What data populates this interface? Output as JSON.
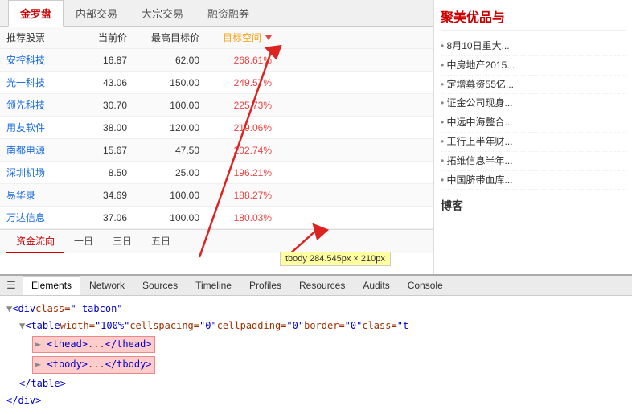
{
  "tabs": {
    "items": [
      {
        "label": "金罗盘",
        "active": true
      },
      {
        "label": "内部交易",
        "active": false
      },
      {
        "label": "大宗交易",
        "active": false
      },
      {
        "label": "融资融券",
        "active": false
      }
    ]
  },
  "table": {
    "headers": {
      "stock": "推荐股票",
      "current_price": "当前价",
      "max_target": "最高目标价",
      "target_space": "目标空间"
    },
    "rows": [
      {
        "name": "安控科技",
        "cur_price": "16.87",
        "max_price": "62.00",
        "space": "268.61%"
      },
      {
        "name": "光一科技",
        "cur_price": "43.06",
        "max_price": "150.00",
        "space": "249.57%"
      },
      {
        "name": "领先科技",
        "cur_price": "30.70",
        "max_price": "100.00",
        "space": "225.73%"
      },
      {
        "name": "用友软件",
        "cur_price": "38.00",
        "max_price": "120.00",
        "space": "219.06%"
      },
      {
        "name": "南都电源",
        "cur_price": "15.67",
        "max_price": "47.50",
        "space": "202.74%"
      },
      {
        "name": "深圳机场",
        "cur_price": "8.50",
        "max_price": "25.00",
        "space": "196.21%"
      },
      {
        "name": "易华录",
        "cur_price": "34.69",
        "max_price": "100.00",
        "space": "188.27%"
      },
      {
        "name": "万达信息",
        "cur_price": "37.06",
        "max_price": "100.00",
        "space": "180.03%"
      }
    ]
  },
  "tooltip": "tbody  284.545px × 210px",
  "bottom_tabs": [
    {
      "label": "资金流向",
      "active": true
    },
    {
      "label": "一日",
      "active": false
    },
    {
      "label": "三日",
      "active": false
    },
    {
      "label": "五日",
      "active": false
    }
  ],
  "right_panel": {
    "company_title": "聚美优品与",
    "news": [
      "8月10日重大...",
      "中房地产2015...",
      "定增募资55亿...",
      "证金公司现身...",
      "中远中海整合...",
      "工行上半年财...",
      "拓维信息半年...",
      "中国脐带血库..."
    ],
    "blog_title": "博客"
  },
  "devtools": {
    "tabs": [
      {
        "label": "Elements",
        "active": true
      },
      {
        "label": "Network",
        "active": false
      },
      {
        "label": "Sources",
        "active": false
      },
      {
        "label": "Timeline",
        "active": false
      },
      {
        "label": "Profiles",
        "active": false
      },
      {
        "label": "Resources",
        "active": false
      },
      {
        "label": "Audits",
        "active": false
      },
      {
        "label": "Console",
        "active": false
      }
    ],
    "code_lines": [
      {
        "indent": 0,
        "content": "▼ <div class=\" tabcon\""
      },
      {
        "indent": 1,
        "content": "▼ <table width=\"100%\" cellspacing=\"0\" cellpadding=\"0\" border=\"0\" class=\"t"
      },
      {
        "indent": 2,
        "highlighted": true,
        "content": "► <thead>...</thead>"
      },
      {
        "indent": 2,
        "highlighted": true,
        "content": "► <tbody>...</tbody>"
      },
      {
        "indent": 1,
        "content": "</table>"
      },
      {
        "indent": 0,
        "content": "</div>"
      }
    ]
  }
}
